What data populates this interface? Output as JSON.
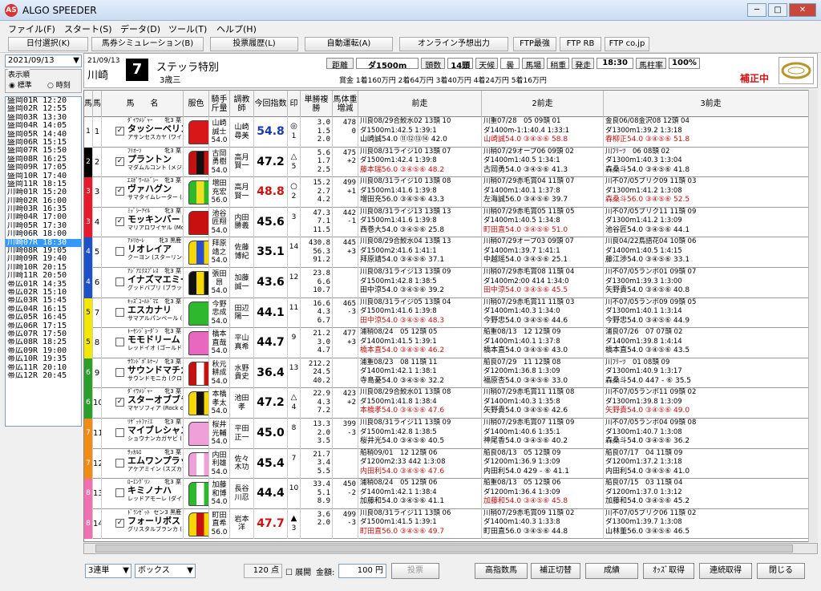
{
  "app": {
    "title": "ALGO SPEEDER",
    "logo": "AS"
  },
  "menu": [
    "ファイル(F)",
    "スタート(S)",
    "データ(D)",
    "ツール(T)",
    "ヘルプ(H)"
  ],
  "toolbar": [
    "日付選択(K)",
    "馬券シミュレーション(B)",
    "投票履歴(L)",
    "自動運転(A)",
    "オンライン予想出力",
    "FTP最強",
    "FTP RB",
    "FTP co.jp"
  ],
  "date": "2021/09/13",
  "order": {
    "label": "表示順",
    "opt1": "標準",
    "opt2": "時刻"
  },
  "races": [
    "盛岡01R 12:20",
    "盛岡02R 12:55",
    "盛岡03R 13:30",
    "盛岡04R 14:05",
    "盛岡05R 14:40",
    "盛岡06R 15:15",
    "盛岡07R 15:50",
    "盛岡08R 16:25",
    "盛岡09R 17:05",
    "盛岡10R 17:40",
    "盛岡11R 18:15",
    "川崎01R 15:20",
    "川崎02R 16:00",
    "川崎03R 16:35",
    "川崎04R 17:00",
    "川崎05R 17:30",
    "川崎06R 18:00",
    "川崎07R 18:30",
    "川崎08R 19:05",
    "川崎09R 19:40",
    "川崎10R 20:15",
    "川崎11R 20:50",
    "帯広01R 14:35",
    "帯広02R 15:10",
    "帯広03R 15:45",
    "帯広04R 16:15",
    "帯広05R 16:45",
    "帯広06R 17:15",
    "帯広07R 17:50",
    "帯広08R 18:25",
    "帯広09R 19:00",
    "帯広10R 19:35",
    "帯広11R 20:10",
    "帯広12R 20:45"
  ],
  "race": {
    "date": "21/09/13",
    "track": "川崎",
    "num": "7",
    "name": "ステッラ特別",
    "cond": "3歳三",
    "dist_label": "距離",
    "dist": "ダ1500m",
    "heads_label": "頭数",
    "heads": "14頭",
    "weather_label": "天候",
    "weather": "曇",
    "ground_label": "馬場",
    "ground": "稍重",
    "start_label": "発走",
    "start": "18:30",
    "rate_label": "馬柱率",
    "rate": "100%",
    "prize": "賞金 1着160万円 2着64万円 3着40万円 4着24万円 5着16万円",
    "hosei": "補正中"
  },
  "cols": [
    "馬",
    "馬",
    "馬　　名",
    "服色",
    "騎手斤量",
    "調教師",
    "今回指数",
    "印",
    "単勝複勝",
    "馬体重増減",
    "前走",
    "2前走",
    "3前走"
  ],
  "horses": [
    {
      "waku": "1",
      "wc": "#ffffff",
      "wt": "#000",
      "no": "1",
      "chk": "✓",
      "sire": "ﾀﾞｲﾜﾒｼﾞｬｰ",
      "sex": "牝3 栗",
      "name": "タッシーベリンダ",
      "dam": "アサンセスカヤ (ワイルドラッシュ)",
      "jk": "山崎",
      "jk2": "誠士",
      "wt2": "54.0",
      "tr": "山崎",
      "tr2": "尋美",
      "idx": "54.8",
      "ic": "#1a3bb5",
      "mk": "◎",
      "mkn": "1",
      "o1": "3.0",
      "o2": "1.5",
      "o3": "2.0",
      "bw": "478",
      "bd": "0",
      "p1a": "川良08/29合鮫水02 13頭 10",
      "p1b": "ダ1500m1:42.5 1:39:1",
      "p1c": "山崎誠54.0 ⑪⑫⑬⑭ 42.0",
      "p1r": "",
      "p2a": "川重07/28　05 09頭 01",
      "p2b": "ダ1400m-1:1:40.4 1:33:1",
      "p2c": "山崎誠54.0 ③④⑤⑥ 58.8",
      "p2r": "r",
      "p3a": "金良06/08金沢08 12頭 04",
      "p3b": "ダ1300m1:39.2 1:3:18",
      "p3c": "春柳正54.0 ③④⑤⑥ 51.8",
      "p3r": "r",
      "silk": "#d81818",
      "silk2": "#d81818"
    },
    {
      "waku": "2",
      "wc": "#000000",
      "wt": "#fff",
      "no": "2",
      "chk": "✓",
      "sire": "ﾌﾘｵｰｿ",
      "sex": "牝3 栗",
      "name": "プラントン",
      "dam": "マダムルコント (メジロライアン)",
      "jk": "古岡",
      "jk2": "勇樹",
      "wt2": "54.0",
      "tr": "高月",
      "tr2": "賢一",
      "idx": "47.2",
      "ic": "#000",
      "mk": "△",
      "mkn": "5",
      "o1": "5.6",
      "o2": "1.7",
      "o3": "2.5",
      "bw": "475",
      "bd": "+2",
      "p1a": "川良08/31ライジ10 13頭 07",
      "p1b": "ダ1500m1:42.4 1:39:8",
      "p1c": "藤本瑞56.0 ③④⑤⑥ 48.2",
      "p1r": "r",
      "p2a": "川稍07/29オープ06 09頭 02",
      "p2b": "ダ1400m1:40.5 1:34:1",
      "p2c": "古岡勇54.0 ③④⑤⑥ 41.3",
      "p2r": "",
      "p3a": "川ﾌﾘｰﾂ　06 08頭 02",
      "p3b": "ダ1300m1:40.3 1:3:04",
      "p3c": "森桑斗54.0 ③④⑤⑥ 41.8",
      "p3r": "",
      "silk": "#c81010",
      "silk2": "#111"
    },
    {
      "waku": "3",
      "wc": "#e8192c",
      "wt": "#fff",
      "no": "3",
      "chk": "✓",
      "sire": "ｴｽﾎﾟﾜｰﾙﾄﾞｼｰ",
      "sex": "牝3 栗",
      "name": "ヴァハグン",
      "dam": "サマタイムレーター (エンドスウィープ)",
      "jk": "増田",
      "jk2": "充宏",
      "wt2": "56.0",
      "tr": "高月",
      "tr2": "賢一",
      "idx": "48.8",
      "ic": "#d01010",
      "mk": "○",
      "mkn": "2",
      "o1": "15.2",
      "o2": "2.7",
      "o3": "4.2",
      "bw": "499",
      "bd": "+1",
      "p1a": "川良08/31ライジ10 13頭 08",
      "p1b": "ダ1500m1:41.6 1:39:8",
      "p1c": "増田充56.0 ③④⑤⑥ 43.3",
      "p1r": "",
      "p2a": "川稍07/29赤毛賞04 11頭 07",
      "p2b": "ダ1400m1:40.1 1:37:8",
      "p2c": "左海誠56.0 ③④⑤⑥ 39.7",
      "p2r": "",
      "p3a": "川不07/05ブリク09 11頭 03",
      "p3b": "ダ1300m1:41.2 1:3:08",
      "p3c": "森桑斗56.0 ③④⑤⑥ 52.5",
      "p3r": "r",
      "silk": "#2eb82e",
      "silk2": "#f0e020"
    },
    {
      "waku": "3",
      "wc": "#e8192c",
      "wt": "#fff",
      "no": "4",
      "chk": "✓",
      "sire": "ﾐｯﾞｼｰｱｲﾙ",
      "sex": "牝3 栗",
      "name": "モッキンバードヒル",
      "dam": "マリアロワイヤル (Montjeu)",
      "jk": "池谷",
      "jk2": "匠翔",
      "wt2": "54.0",
      "tr": "内田",
      "tr2": "勝義",
      "idx": "45.6",
      "ic": "#000",
      "mk": "",
      "mkn": "3",
      "o1": "47.3",
      "o2": "7.1",
      "o3": "11.5",
      "bw": "442",
      "bd": "-1",
      "p1a": "川良08/31ライジ13 13頭 13",
      "p1b": "ダ1500m1:41.6 1:39:8",
      "p1c": "西巻大54.0 ③④⑤⑥ 25.8",
      "p1r": "",
      "p2a": "川稍07/29赤毛賞05 11頭 05",
      "p2b": "ダ1400m1:40.5 1:34:8",
      "p2c": "町田直54.0 ③④⑤⑥ 51.0",
      "p2r": "r",
      "p3a": "川不07/05ブリク11 11頭 09",
      "p3b": "ダ1300m1:41.2 1:3:09",
      "p3c": "池谷匠54.0 ③④⑤⑥ 44.1",
      "p3r": "",
      "silk": "#c81010",
      "silk2": "#c81010"
    },
    {
      "waku": "4",
      "wc": "#1e50c8",
      "wt": "#fff",
      "no": "5",
      "chk": "",
      "sire": "ｱﾒﾘｶｰﾚ",
      "sex": "牝3 黒鹿",
      "name": "リオレイア",
      "dam": "クーヨン (スターリングローズ)",
      "jk": "拜原",
      "jk2": "靖之",
      "wt2": "54.0",
      "tr": "佐藤",
      "tr2": "博紀",
      "idx": "35.1",
      "ic": "#000",
      "mk": "",
      "mkn": "14",
      "o1": "430.8",
      "o2": "56.3",
      "o3": "91.2",
      "bw": "445",
      "bd": "+3",
      "p1a": "川良08/29合鮫水04 13頭 13",
      "p1b": "ダ1500m2:41.6 1:41:1",
      "p1c": "拜原靖54.0 ③④⑤⑥ 37.1",
      "p1r": "",
      "p2a": "川稍07/29オープ03 09頭 07",
      "p2b": "ダ1400m1:39.7 1:41:1",
      "p2c": "中越瑶54.0 ③④⑤⑥ 25.1",
      "p2r": "",
      "p3a": "川良04/22鳥語花04 10頭 06",
      "p3b": "ダ1400m1:40.5 1:4:15",
      "p3c": "藤江渉54.0 ③④⑤⑥ 33.1",
      "p3r": "",
      "silk": "#f5d800",
      "silk2": "#2850d0"
    },
    {
      "waku": "4",
      "wc": "#1e50c8",
      "wt": "#fff",
      "no": "6",
      "chk": "",
      "sire": "ｱｼﾞｱｴｸｽﾌﾟﾚｽ",
      "sex": "牝3 栗",
      "name": "イナズマエミール",
      "dam": "グッドバブリ (ブラックタイド)",
      "jk": "張田",
      "jk2": "昂",
      "wt2": "54.0",
      "tr": "加藤",
      "tr2": "誠一",
      "idx": "43.6",
      "ic": "#000",
      "mk": "",
      "mkn": "12",
      "o1": "23.8",
      "o2": "6.6",
      "o3": "10.7",
      "bw": "",
      "bd": "",
      "p1a": "川良08/31ライジ13 13頭 09",
      "p1b": "ダ1500m1:42.8 1:38:5",
      "p1c": "田中涼54.0 ③④⑤⑥ 39.2",
      "p1r": "",
      "p2a": "川稍07/29赤毛賞08 11頭 04",
      "p2b": "ダ1400m2:00 414 1:34:0",
      "p2c": "田中涼54.0 ③④⑤⑥ 45.5",
      "p2r": "r",
      "p3a": "川不07/05ランボ01 09頭 07",
      "p3b": "ダ1300m1:39.3 1:3:00",
      "p3c": "矢野貴54.0 ③④⑤⑥ 40.8",
      "p3r": "",
      "silk": "#111",
      "silk2": "#f5d800"
    },
    {
      "waku": "5",
      "wc": "#f5e800",
      "wt": "#000",
      "no": "7",
      "chk": "",
      "sire": "ｷｯｽﾞｺｰﾙﾄﾞﾏｴ",
      "sex": "牝3 栗",
      "name": "エスカナリ",
      "dam": "サマアルパンベール (マンハッタンカフェ)",
      "jk": "今野",
      "jk2": "忠成",
      "wt2": "54.0",
      "tr": "田辺",
      "tr2": "陽一",
      "idx": "44.1",
      "ic": "#000",
      "mk": "",
      "mkn": "11",
      "o1": "16.6",
      "o2": "4.3",
      "o3": "6.7",
      "bw": "465",
      "bd": "-3",
      "p1a": "川良08/31ライジ05 13頭 04",
      "p1b": "ダ1500m1:41.6 1:39:8",
      "p1c": "田中涼54.0 ③④⑤⑥ 48.3",
      "p1r": "r",
      "p2a": "川稍07/29赤毛賞11 11頭 03",
      "p2b": "ダ1400m1:40.3 1:34:0",
      "p2c": "今野忠54.0 ③④⑤⑥ 44.6",
      "p2r": "",
      "p3a": "川不07/05ランボ09 09頭 05",
      "p3b": "ダ1300m1:40.1 1:3:14",
      "p3c": "今野忠54.0 ③④⑤⑥ 44.9",
      "p3r": "",
      "silk": "#2eb82e",
      "silk2": "#2eb82e"
    },
    {
      "waku": "5",
      "wc": "#f5e800",
      "wt": "#000",
      "no": "8",
      "chk": "",
      "sire": "ﾄｰｾﾝｼﾞｮｰﾀﾞﾝ",
      "sex": "牝3 栗",
      "name": "モモドリーム",
      "dam": "レッドイオ (ゴールドアリュール)",
      "jk": "橋本",
      "jk2": "直哉",
      "wt2": "54.0",
      "tr": "平山",
      "tr2": "真希",
      "idx": "44.7",
      "ic": "#000",
      "mk": "",
      "mkn": "9",
      "o1": "21.2",
      "o2": "3.0",
      "o3": "4.7",
      "bw": "477",
      "bd": "+3",
      "p1a": "浦稍08/24　05 12頭 05",
      "p1b": "ダ1400m1:41.5 1:39:1",
      "p1c": "橋本直54.0 ③④⑤⑥ 46.2",
      "p1r": "r",
      "p2a": "船重08/13　12 12頭 09",
      "p2b": "ダ1400m1:40.1 1:37:8",
      "p2c": "橋本直54.0 ③④⑤⑥ 43.0",
      "p2r": "",
      "p3a": "浦良07/26　07 07頭 02",
      "p3b": "ダ1400m1:39.8 1:4:14",
      "p3c": "橋本直54.0 ③④⑤⑥ 43.5",
      "p3r": "",
      "silk": "#e868c0",
      "silk2": "#e868c0"
    },
    {
      "waku": "6",
      "wc": "#2aa02a",
      "wt": "#fff",
      "no": "9",
      "chk": "",
      "sire": "ｻｳﾝﾄﾞﾎﾟﾙｹｰﾉ",
      "sex": "牝3 栗",
      "name": "サウンドマチカ",
      "dam": "サウンドモニカ (クロフネ)",
      "jk": "秋元",
      "jk2": "耕成",
      "wt2": "54.0",
      "tr": "水野",
      "tr2": "貴史",
      "idx": "36.4",
      "ic": "#000",
      "mk": "",
      "mkn": "13",
      "o1": "212.2",
      "o2": "24.5",
      "o3": "40.2",
      "bw": "",
      "bd": "",
      "p1a": "浦重08/23　08 11頭 11",
      "p1b": "ダ1400m1:42.1 1:38:1",
      "p1c": "寺島憂54.0 ③④⑤⑥ 32.2",
      "p1r": "",
      "p2a": "船良07/29　11 12頭 08",
      "p2b": "ダ1200m1:36.8 1:3:09",
      "p2c": "福原杏54.0 ③④⑤⑥ 33.0",
      "p2r": "",
      "p3a": "川ﾌﾘｰﾂ　01 08頭 09",
      "p3b": "ダ1300m1:40.9 1:3:17",
      "p3c": "森桑斗54.0 447 - ⑥ 35.5",
      "p3r": "",
      "silk": "#c81010",
      "silk2": "#fff"
    },
    {
      "waku": "6",
      "wc": "#2aa02a",
      "wt": "#fff",
      "no": "10",
      "chk": "✓",
      "sire": "ﾀﾞｲﾜﾒｼﾞｬｰ",
      "sex": "牝3 栗",
      "name": "スターオブブラッド",
      "dam": "マヤソフィア (Rock of Gibralta",
      "jk": "本橋",
      "jk2": "孝太",
      "wt2": "54.0",
      "tr": "池田",
      "tr2": "孝",
      "idx": "47.2",
      "ic": "#000",
      "mk": "△",
      "mkn": "4",
      "o1": "22.9",
      "o2": "4.3",
      "o3": "7.2",
      "bw": "423",
      "bd": "+2",
      "p1a": "川良08/29合鮫水01 13頭 08",
      "p1b": "ダ1500m1:41.8 1:38:4",
      "p1c": "本橋孝54.0 ③④⑤⑥ 47.6",
      "p1r": "r",
      "p2a": "川稍07/29赤毛賞11 11頭 08",
      "p2b": "ダ1400m1:40.3 1:35:8",
      "p2c": "矢野貴54.0 ③④⑤⑥ 42.6",
      "p2r": "",
      "p3a": "川不07/05ランボ11 09頭 02",
      "p3b": "ダ1300m1:39.8 1:3:09",
      "p3c": "矢野貴54.0 ③④⑤⑥ 49.0",
      "p3r": "r",
      "silk": "#f5d800",
      "silk2": "#111"
    },
    {
      "waku": "7",
      "wc": "#f08c14",
      "wt": "#fff",
      "no": "11",
      "chk": "",
      "sire": "ﾘｻﾞｯﾄﾌｧﾐｴ",
      "sex": "牝3 栗",
      "name": "マイブレシャスワン",
      "dam": "ショウナンカガヤビ (フレンチデピュティ)",
      "jk": "桜井",
      "jk2": "光輔",
      "wt2": "54.0",
      "tr": "平田",
      "tr2": "正一",
      "idx": "45.0",
      "ic": "#000",
      "mk": "",
      "mkn": "8",
      "o1": "13.3",
      "o2": "2.0",
      "o3": "3.5",
      "bw": "399",
      "bd": "-3",
      "p1a": "川良08/31ライジ11 13頭 09",
      "p1b": "ダ1500m1:42.8 1:38:5",
      "p1c": "桜井光54.0 ③④⑤⑥ 40.5",
      "p1r": "",
      "p2a": "川稍07/29赤毛賞07 11頭 09",
      "p2b": "ダ1400m1:40.6 1:35:1",
      "p2c": "神尾香54.0 ③④⑤⑥ 40.2",
      "p2r": "",
      "p3a": "川不07/05ランボ04 09頭 08",
      "p3b": "ダ1300m1:40.7 1:3:08",
      "p3c": "森桑斗54.0 ③④⑤⑥ 36.2",
      "p3r": "",
      "silk": "#f0a0d8",
      "silk2": "#f0a0d8"
    },
    {
      "waku": "7",
      "wc": "#f08c14",
      "wt": "#fff",
      "no": "12",
      "chk": "",
      "sire": "ｻｯｶﾙﾛ",
      "sex": "牝3 栗",
      "name": "エムワンプラッサム",
      "dam": "アケアミイン (スズカマンボ)",
      "jk": "内田",
      "jk2": "利雄",
      "wt2": "54.0",
      "tr": "佐々",
      "tr2": "木功",
      "idx": "45.4",
      "ic": "#000",
      "mk": "",
      "mkn": "7",
      "o1": "21.7",
      "o2": "3.4",
      "o3": "5.5",
      "bw": "",
      "bd": "",
      "p1a": "船稍09/01　12 12頭 06",
      "p1b": "ダ1200m2:33 442 1:3:08",
      "p1c": "内田利54.0 ③④⑤⑥ 47.6",
      "p1r": "r",
      "p2a": "船良08/13　05 12頭 09",
      "p2b": "ダ1200m1:36.9 1:3:09",
      "p2c": "内田利54.0 429 - ⑥ 41.1",
      "p2r": "",
      "p3a": "船良07/17　04 11頭 09",
      "p3b": "ダ1200m1:37.2 1:3:18",
      "p3c": "内田利54.0 ③④⑤⑥ 41.0",
      "p3r": "",
      "silk": "#f0a0d8",
      "silk2": "#fff"
    },
    {
      "waku": "8",
      "wc": "#f070b0",
      "wt": "#fff",
      "no": "13",
      "chk": "",
      "sire": "ﾛｰｴﾝｸﾞﾘﾝ",
      "sex": "牝3 栗",
      "name": "キミノナハ",
      "dam": "レッドアモーレ (ダイワメジャー)",
      "jk": "加藤",
      "jk2": "和博",
      "wt2": "54.0",
      "tr": "長谷",
      "tr2": "川忍",
      "idx": "44.4",
      "ic": "#000",
      "mk": "",
      "mkn": "10",
      "o1": "33.4",
      "o2": "5.1",
      "o3": "8.9",
      "bw": "450",
      "bd": "-2",
      "p1a": "浦稍08/24　05 12頭 06",
      "p1b": "ダ1400m1:42.1 1:38:4",
      "p1c": "加藤和54.0 ③④⑤⑥ 41.1",
      "p1r": "",
      "p2a": "船重08/13　05 12頭 06",
      "p2b": "ダ1200m1:36.4 1:3:09",
      "p2c": "加藤和54.0 ③④⑤⑥ 45.8",
      "p2r": "r",
      "p3a": "船良07/15　03 11頭 04",
      "p3b": "ダ1200m1:37.0 1:3:12",
      "p3c": "加藤和54.0 ③④⑤⑥ 45.2",
      "p3r": "",
      "silk": "#2eb82e",
      "silk2": "#fff"
    },
    {
      "waku": "8",
      "wc": "#f070b0",
      "wt": "#fff",
      "no": "14",
      "chk": "✓",
      "sire": "ﾄﾞﾗﾝｾﾞｯﾄ",
      "sex": "セン3 黒鹿",
      "name": "フォーリボス",
      "dam": "グリスタルブランカ (ネオユニヴァース)",
      "jk": "町田",
      "jk2": "直希",
      "wt2": "56.0",
      "tr": "岩本",
      "tr2": "洋",
      "idx": "47.7",
      "ic": "#d01010",
      "mk": "▲",
      "mkn": "3",
      "o1": "3.6",
      "o2": "2.0",
      "o3": "",
      "bw": "499",
      "bd": "-3",
      "p1a": "川良08/31ライジ11 13頭 06",
      "p1b": "ダ1500m1:41.5 1:39:1",
      "p1c": "町田直56.0 ③④⑤⑥ 49.7",
      "p1r": "r",
      "p2a": "川稍07/29赤毛賞09 11頭 02",
      "p2b": "ダ1400m1:40.3 1:33:8",
      "p2c": "町田直56.0 ③④⑤⑥ 44.8",
      "p2r": "",
      "p3a": "川不07/05ブリク06 11頭 02",
      "p3b": "ダ1300m1:39.7 1:3:08",
      "p3c": "山林董56.0 ③④⑤⑥ 46.5",
      "p3r": "",
      "silk": "#f5d800",
      "silk2": "#c81010"
    }
  ],
  "bottom": {
    "bet": "3連単",
    "mode": "ボックス",
    "points": "120 点",
    "expand": "展開",
    "amount_label": "金額:",
    "amount": "100 円",
    "vote": "投票",
    "btns": [
      "高指数馬",
      "補正切替",
      "成績",
      "ｵｯｽﾞ取得",
      "連続取得",
      "閉じる"
    ]
  },
  "colors": {
    "accent": "#3399ff",
    "red": "#d01010",
    "blue": "#1a3bb5"
  }
}
